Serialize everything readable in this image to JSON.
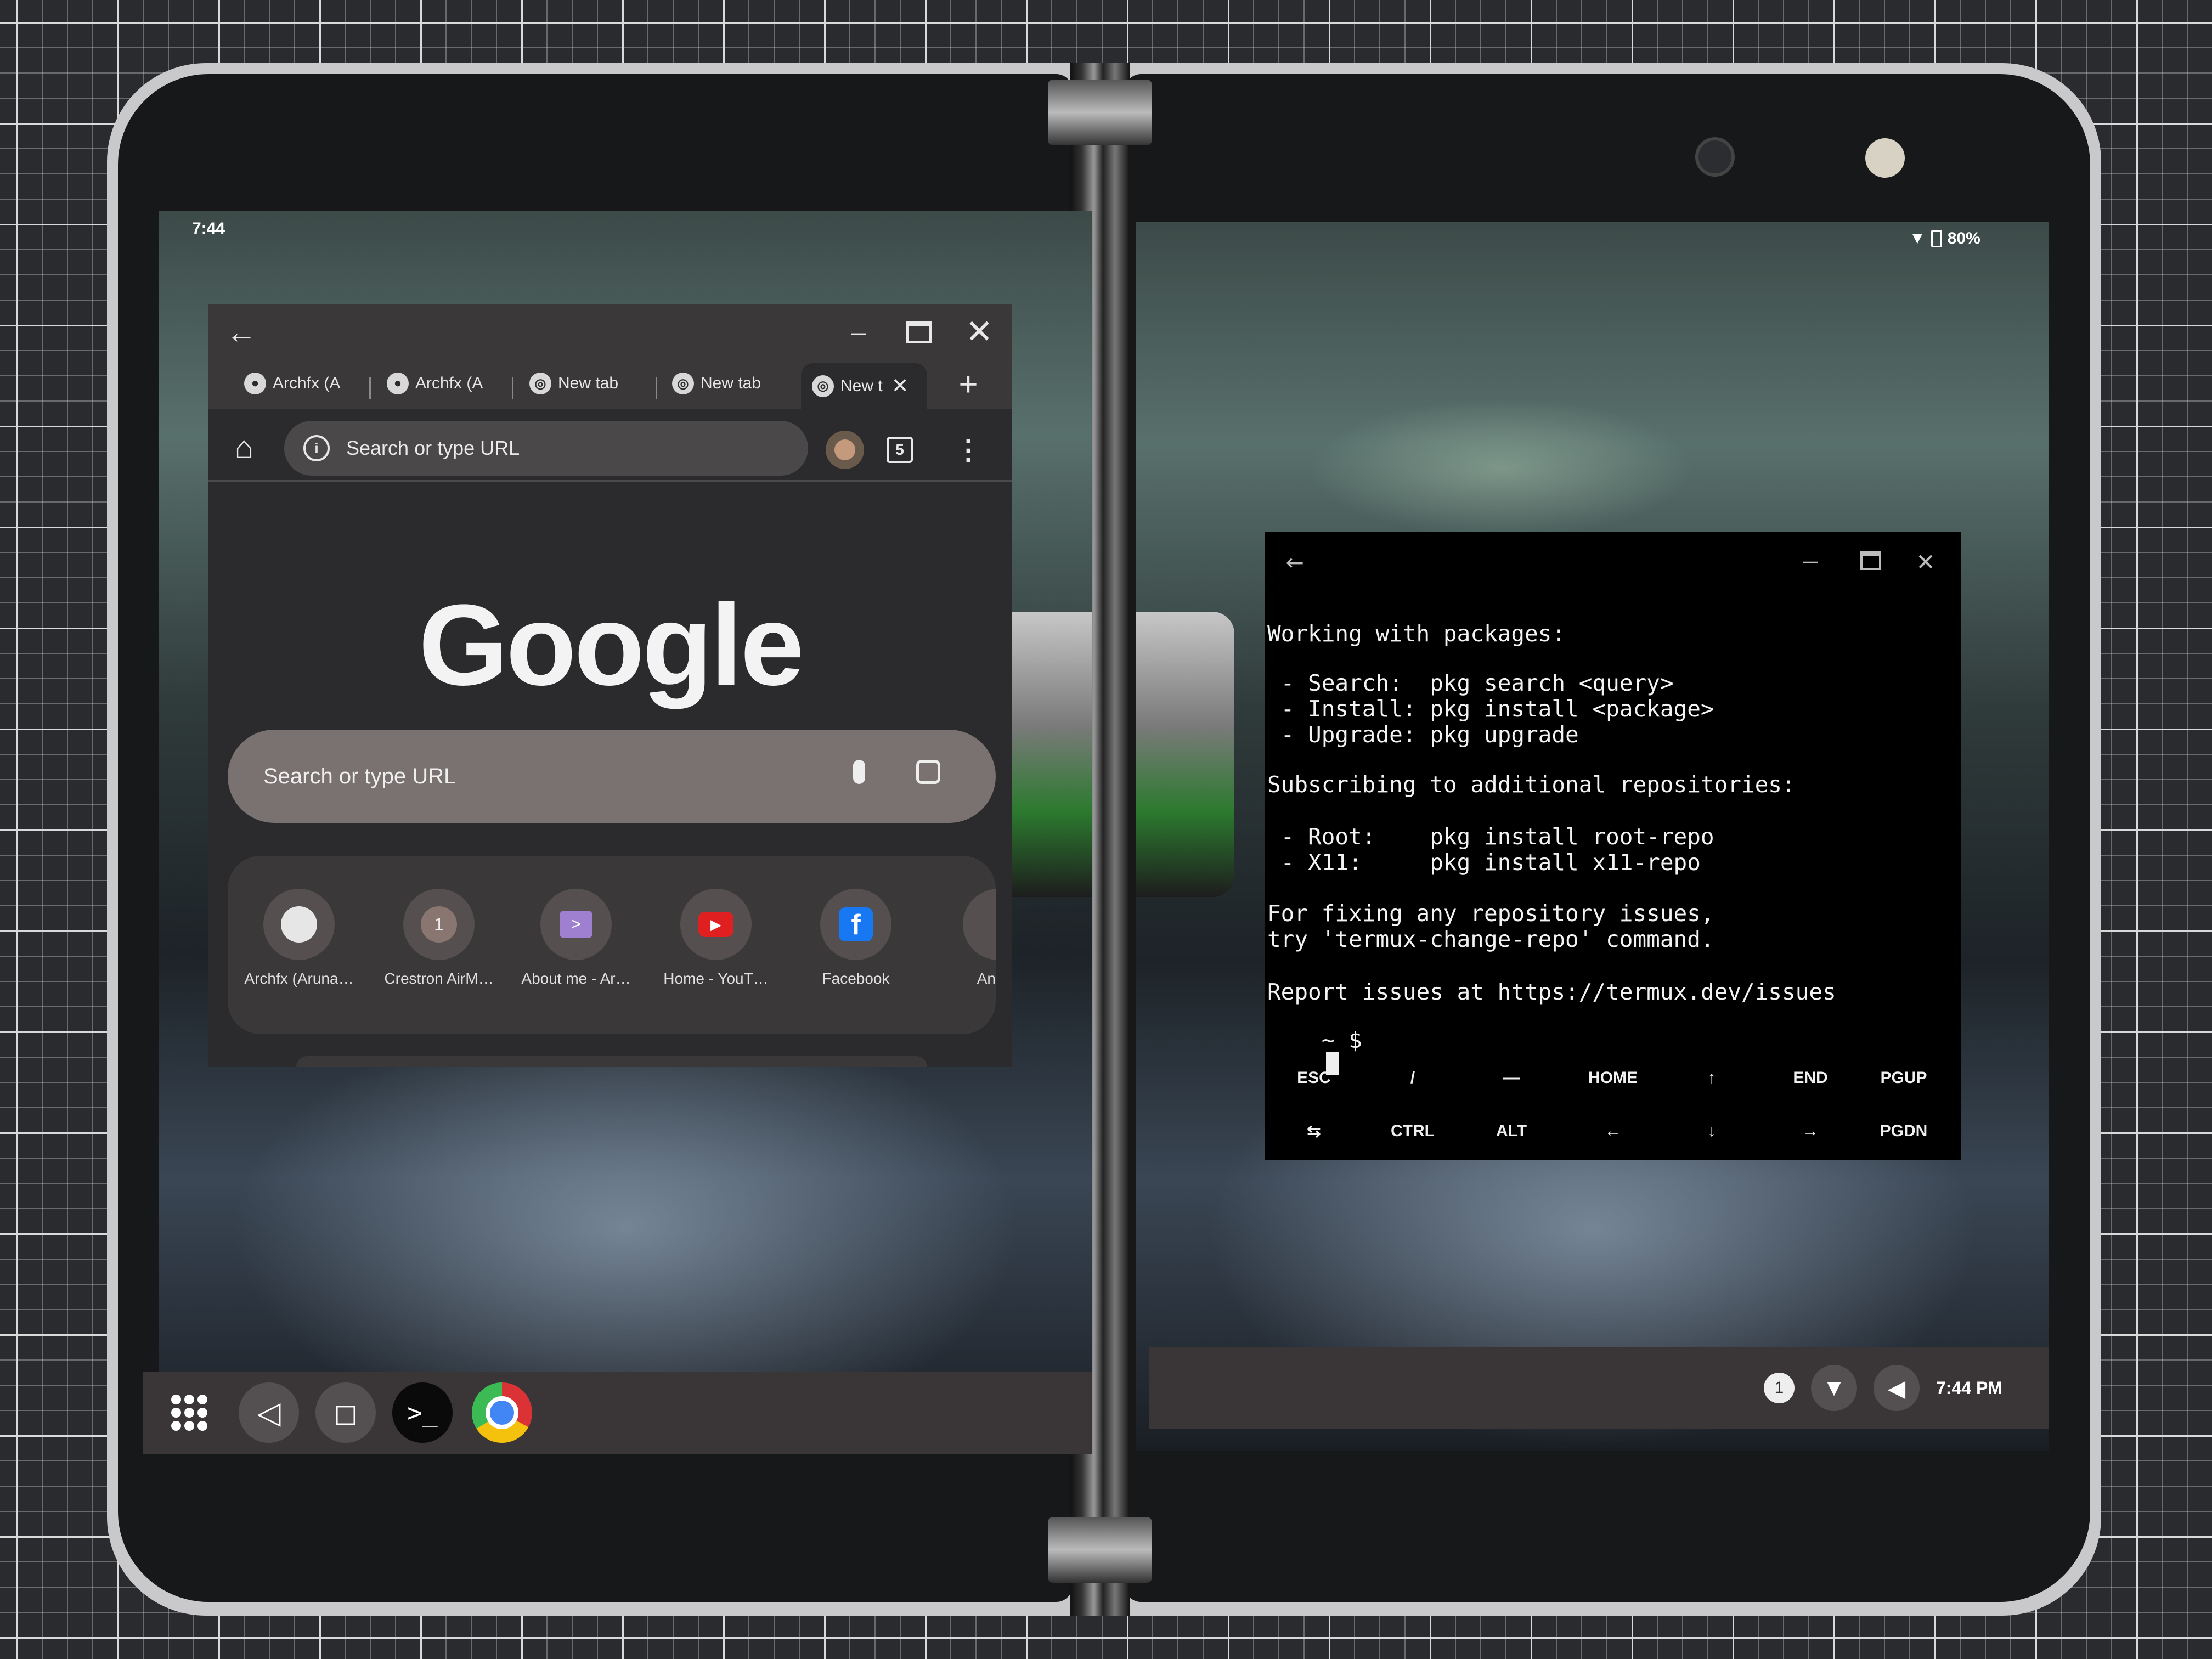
{
  "status_bar": {
    "time": "7:44",
    "battery": "80%"
  },
  "chrome": {
    "tabs": [
      {
        "label": "Archfx (A",
        "icon": "github-icon"
      },
      {
        "label": "Archfx (A",
        "icon": "github-icon"
      },
      {
        "label": "New tab",
        "icon": "chrome-icon"
      },
      {
        "label": "New tab",
        "icon": "chrome-icon"
      },
      {
        "label": "New t",
        "icon": "chrome-icon",
        "active": true
      }
    ],
    "omnibox_placeholder": "Search or type URL",
    "tab_count": "5",
    "logo": "Google",
    "ntp_search_placeholder": "Search or type URL",
    "shortcuts": [
      {
        "label": "Archfx (Aruna…",
        "icon": "github-icon"
      },
      {
        "label": "Crestron AirM…",
        "icon": "1"
      },
      {
        "label": "About me - Ar…",
        "icon": "terminal-icon"
      },
      {
        "label": "Home - YouT…",
        "icon": "youtube-icon"
      },
      {
        "label": "Facebook",
        "icon": "facebook-icon"
      },
      {
        "label": "An",
        "icon": ""
      }
    ]
  },
  "termux": {
    "lines": [
      "Working with packages:",
      "",
      " - Search:  pkg search <query>",
      " - Install: pkg install <package>",
      " - Upgrade: pkg upgrade",
      "",
      "Subscribing to additional repositories:",
      "",
      " - Root:    pkg install root-repo",
      " - X11:     pkg install x11-repo",
      "",
      "For fixing any repository issues,",
      "try 'termux-change-repo' command.",
      "",
      "Report issues at https://termux.dev/issues"
    ],
    "prompt": "~ $",
    "extra_keys_row1": [
      "ESC",
      "/",
      "—",
      "HOME",
      "↑",
      "END",
      "PGUP"
    ],
    "extra_keys_row2": [
      "⇆",
      "CTRL",
      "ALT",
      "←",
      "↓",
      "→",
      "PGDN"
    ]
  },
  "tray": {
    "notification_count": "1",
    "time": "7:44 PM"
  }
}
